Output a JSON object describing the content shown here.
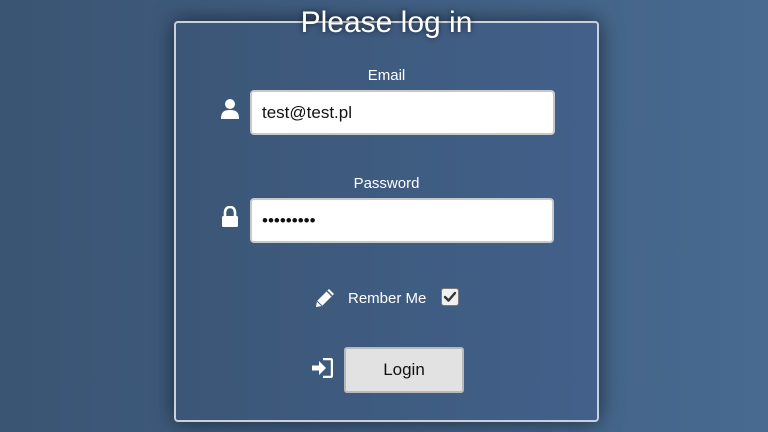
{
  "form": {
    "title": "Please log in",
    "email": {
      "label": "Email",
      "value": "test@test.pl",
      "icon": "user-icon"
    },
    "password": {
      "label": "Password",
      "value": "password1",
      "icon": "lock-icon"
    },
    "remember": {
      "label": "Rember Me",
      "checked": true,
      "icon": "pencil-icon"
    },
    "login": {
      "label": "Login",
      "icon": "sign-in-icon"
    }
  },
  "colors": {
    "background": "#415f83",
    "panel_border": "#c9d1dc",
    "text": "#ffffff",
    "button_bg": "#e2e2e2"
  }
}
